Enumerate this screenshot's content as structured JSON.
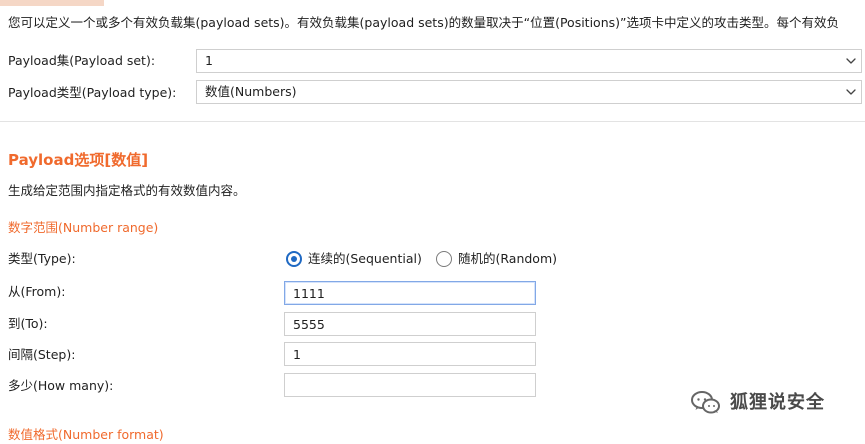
{
  "description": "您可以定义一个或多个有效负载集(payload sets)。有效负载集(payload sets)的数量取决于“位置(Positions)”选项卡中定义的攻击类型。每个有效负",
  "payload_set": {
    "label": "Payload集(Payload set):",
    "value": "1",
    "icon": "chevron-down-icon"
  },
  "payload_type": {
    "label": "Payload类型(Payload type):",
    "value": "数值(Numbers)",
    "icon": "chevron-down-icon"
  },
  "options": {
    "title": "Payload选项[数值]",
    "description": "生成给定范围内指定格式的有效数值内容。"
  },
  "number_range": {
    "heading": "数字范围(Number range)",
    "type_label": "类型(Type):",
    "sequential_label": "连续的(Sequential)",
    "random_label": "随机的(Random)",
    "from_label": "从(From):",
    "from_value": "1111",
    "to_label": "到(To):",
    "to_value": "5555",
    "step_label": "间隔(Step):",
    "step_value": "1",
    "how_many_label": "多少(How many):",
    "how_many_value": ""
  },
  "number_format": {
    "heading": "数值格式(Number format)"
  },
  "watermark": {
    "text": "狐狸说安全",
    "icon": "wechat-icon"
  },
  "colors": {
    "accent": "#f06a2d",
    "selected_radio": "#1f69c3",
    "active_border": "#82a8e6"
  }
}
